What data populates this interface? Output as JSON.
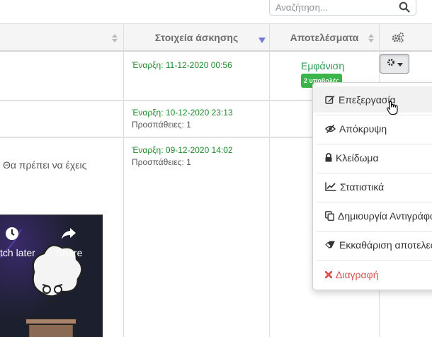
{
  "search": {
    "placeholder": "Αναζήτηση..."
  },
  "table": {
    "headers": {
      "exercise_data": "Στοιχεία άσκησης",
      "results": "Αποτελέσματα"
    },
    "rows": [
      {
        "start": "Έναρξη: 11-12-2020 00:56",
        "attempts": "",
        "results_link": "Εμφάνιση",
        "badge": "2 υποβολές"
      },
      {
        "start": "Έναρξη: 10-12-2020 23:13",
        "attempts": "Προσπάθειες: 1"
      },
      {
        "start": "Έναρξη: 09-12-2020 14:02",
        "attempts": "Προσπάθειες: 1",
        "description": "Θα πρέπει να έχεις"
      }
    ]
  },
  "video": {
    "watch_later": "tch later",
    "share": "Share"
  },
  "menu": {
    "items": [
      {
        "label": "Επεξεργασία",
        "icon": "edit-icon"
      },
      {
        "label": "Απόκρυψη",
        "icon": "eye-slash-icon"
      },
      {
        "label": "Κλείδωμα",
        "icon": "lock-icon"
      },
      {
        "label": "Στατιστικά",
        "icon": "line-chart-icon"
      },
      {
        "label": "Δημιουργία Αντιγράφου",
        "icon": "copy-icon"
      },
      {
        "label": "Εκκαθάριση αποτελεσμάτων",
        "icon": "eraser-icon"
      },
      {
        "label": "Διαγραφή",
        "icon": "delete-icon"
      }
    ]
  },
  "colors": {
    "green": "#1e8a2e",
    "badge": "#39b54a",
    "danger": "#d9534f",
    "header_bg": "#f5f5f5"
  }
}
